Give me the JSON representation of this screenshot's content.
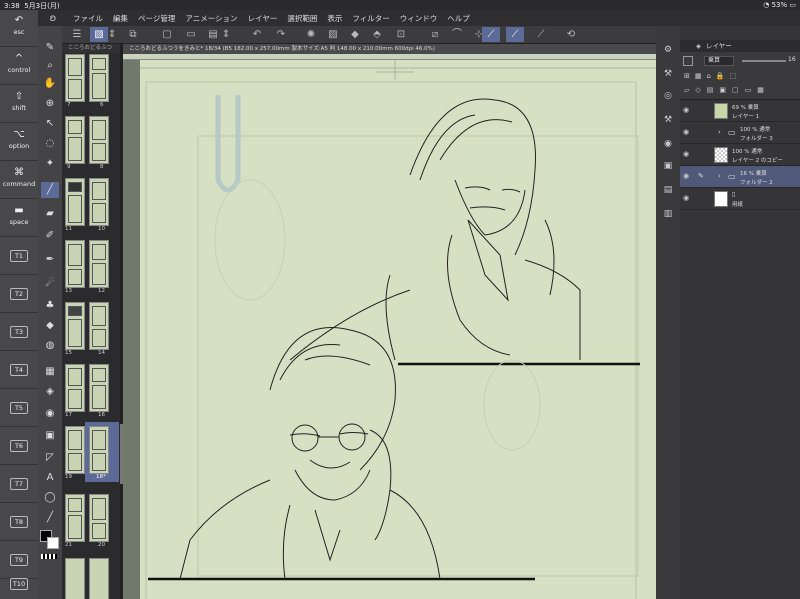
{
  "status": {
    "time": "3:38",
    "date": "5月3日(月)",
    "battery": "53%"
  },
  "menu": [
    "ファイル",
    "編集",
    "ページ管理",
    "アニメーション",
    "レイヤー",
    "選択範囲",
    "表示",
    "フィルター",
    "ウィンドウ",
    "ヘルプ"
  ],
  "keys": [
    {
      "glyph": "↶",
      "label": "esc"
    },
    {
      "glyph": "^",
      "label": "control"
    },
    {
      "glyph": "⇧",
      "label": "shift"
    },
    {
      "glyph": "⌥",
      "label": "option"
    },
    {
      "glyph": "⌘",
      "label": "command"
    },
    {
      "glyph": "▬",
      "label": "space"
    },
    {
      "label": "T1"
    },
    {
      "label": "T2"
    },
    {
      "label": "T3"
    },
    {
      "label": "T4"
    },
    {
      "label": "T5"
    },
    {
      "label": "T6"
    },
    {
      "label": "T7"
    },
    {
      "label": "T8"
    },
    {
      "label": "T9"
    },
    {
      "label": "T10"
    }
  ],
  "canvas": {
    "info": "こころおどるふつうをきみと* 18/34 (B5 182.00 x 257.00mm 製本サイズ:A5 判 148.00 x 210.00mm 600dpi 46.0%)",
    "page_list_title": "こころおどるふつ"
  },
  "pages": [
    {
      "left": "7",
      "right": "6"
    },
    {
      "left": "9",
      "right": "8"
    },
    {
      "left": "11",
      "right": "10"
    },
    {
      "left": "13",
      "right": "12"
    },
    {
      "left": "15",
      "right": "14"
    },
    {
      "left": "17",
      "right": "16"
    },
    {
      "left": "19",
      "right": "18*"
    },
    {
      "left": "21",
      "right": "20"
    }
  ],
  "layers_panel": {
    "title": "レイヤー",
    "blend_mode": "乗算",
    "opacity": "16",
    "rows": [
      {
        "line1": "69 % 乗算",
        "line2": "レイヤー 1",
        "thumb": "#c7d8a8",
        "selected": false,
        "folder": false
      },
      {
        "line1": "100 % 通常",
        "line2": "フォルダー 3",
        "thumb": "",
        "selected": false,
        "folder": true
      },
      {
        "line1": "100 % 通常",
        "line2": "レイヤー 2 のコピー",
        "thumb": "checker",
        "selected": false,
        "folder": false
      },
      {
        "line1": "16 % 乗算",
        "line2": "フォルダー 2",
        "thumb": "",
        "selected": true,
        "folder": true
      },
      {
        "line1": "",
        "line2": "用紙",
        "thumb": "#ffffff",
        "selected": false,
        "folder": false
      }
    ]
  },
  "colors": {
    "paper": "#d6e1c3",
    "selection": "#5b6a96"
  }
}
